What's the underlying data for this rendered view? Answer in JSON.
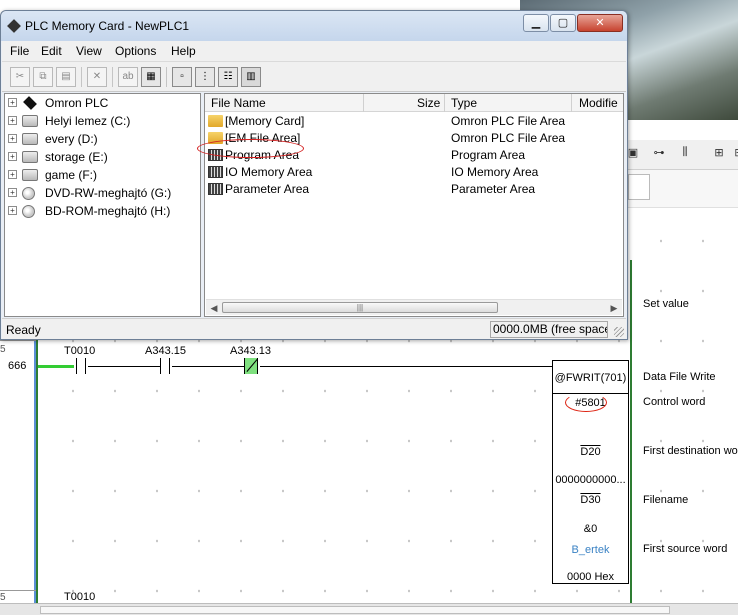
{
  "window": {
    "title": "PLC Memory Card - NewPLC1",
    "controls": [
      "minimize",
      "maximize",
      "close"
    ],
    "menu": [
      "File",
      "Edit",
      "View",
      "Options",
      "Help"
    ],
    "toolbar_icons": [
      "cut-icon",
      "copy-icon",
      "paste-icon",
      "delete-icon",
      "rename-icon",
      "properties-icon",
      "large-icons-icon",
      "small-icons-icon",
      "list-view-icon",
      "details-view-icon"
    ],
    "tree": [
      {
        "label": "Omron PLC",
        "icon": "plc-icon"
      },
      {
        "label": "Helyi lemez (C:)",
        "icon": "drive-icon"
      },
      {
        "label": "every (D:)",
        "icon": "drive-icon"
      },
      {
        "label": "storage (E:)",
        "icon": "drive-icon"
      },
      {
        "label": "game (F:)",
        "icon": "drive-icon"
      },
      {
        "label": "DVD-RW-meghajtó (G:)",
        "icon": "disc-icon"
      },
      {
        "label": "BD-ROM-meghajtó (H:)",
        "icon": "disc-icon"
      }
    ],
    "list_columns": [
      "File Name",
      "Size",
      "Type",
      "Modifie"
    ],
    "rows": [
      {
        "name": "[Memory Card]",
        "type": "Omron PLC File Area",
        "icon": "folder-icon"
      },
      {
        "name": "[EM File Area]",
        "type": "Omron PLC File Area",
        "icon": "folder-icon"
      },
      {
        "name": "Program Area",
        "type": "Program Area",
        "icon": "chip-icon"
      },
      {
        "name": "IO Memory Area",
        "type": "IO Memory Area",
        "icon": "chip-icon"
      },
      {
        "name": "Parameter Area",
        "type": "Parameter Area",
        "icon": "chip-icon"
      }
    ],
    "status": {
      "left": "Ready",
      "right": "0000.0MB (free space"
    }
  },
  "ladder": {
    "rung_number": "666",
    "contacts": [
      "T0010",
      "A343.15",
      "A343.13"
    ],
    "instruction": "@FWRIT(701)",
    "operands": [
      "#5801",
      "D20",
      "0000000000...",
      "D30",
      "&0",
      "B_ertek",
      "0000 Hex"
    ],
    "next_rung_contact": "T0010",
    "descriptions": [
      "Set value",
      "Data File Write",
      "Control word",
      "First destination wor",
      "Filename",
      "First source word"
    ]
  }
}
